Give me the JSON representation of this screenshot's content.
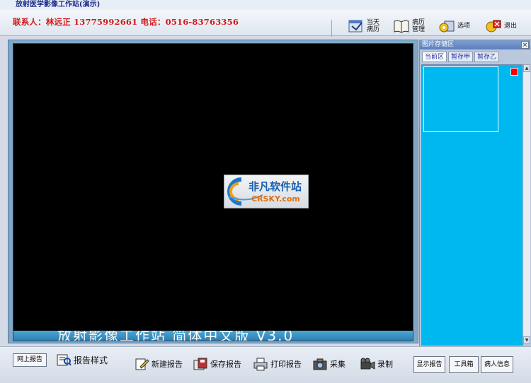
{
  "window": {
    "title": "放射医学影像工作站(演示)"
  },
  "header": {
    "contact": "联系人：林远正 13775992661  电话：0516-83763356",
    "toolbar": [
      {
        "label1": "当天",
        "label2": "病历",
        "icon": "calendar-records-icon"
      },
      {
        "label1": "病历",
        "label2": "管理",
        "icon": "book-icon"
      },
      {
        "label1": "选项",
        "label2": "",
        "icon": "options-icon"
      },
      {
        "label1": "退出",
        "label2": "",
        "icon": "exit-icon"
      }
    ]
  },
  "viewer": {
    "overlay_text": "放射影像工作站  简体中文版 V3.0",
    "logo_cn": "非凡软件站",
    "logo_en": "CRSKY.com"
  },
  "panel": {
    "title": "图片存储区",
    "close": "×",
    "tabs": [
      "当前区",
      "暂存甲",
      "暂存乙"
    ]
  },
  "bottom": {
    "online_report": "网上报告",
    "report_style": "报告样式",
    "tools": [
      {
        "label": "新建报告",
        "icon": "new-report-icon"
      },
      {
        "label": "保存报告",
        "icon": "save-report-icon"
      },
      {
        "label": "打印报告",
        "icon": "print-report-icon"
      },
      {
        "label": "采集",
        "icon": "camera-icon"
      },
      {
        "label": "录制",
        "icon": "video-camera-icon"
      }
    ],
    "buttons": [
      "显示报告",
      "工具箱",
      "病人信息"
    ]
  },
  "colors": {
    "accent": "#00b8f0",
    "contact": "#d01818",
    "viewer_bg": "#000000"
  }
}
